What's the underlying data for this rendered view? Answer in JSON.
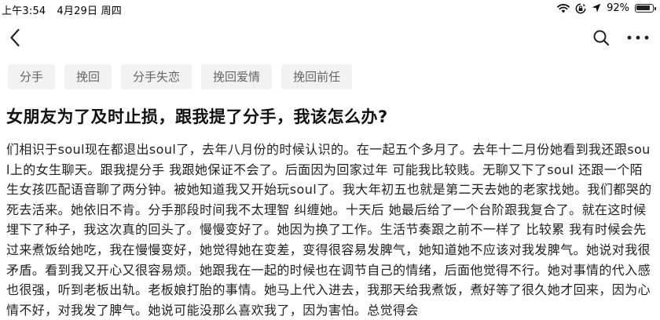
{
  "status_bar": {
    "time": "上午3:54",
    "date": "4月29日 周四",
    "battery": "92%",
    "battery_level": 0.92,
    "icons": [
      "wifi-icon",
      "screen-lock-icon",
      "location-icon",
      "battery-icon"
    ]
  },
  "nav": {
    "icons": [
      "back-chevron-icon",
      "search-icon",
      "more-icon"
    ]
  },
  "tags": [
    "分手",
    "挽回",
    "分手失恋",
    "挽回爱情",
    "挽回前任"
  ],
  "article": {
    "title": "女朋友为了及时止损，跟我提了分手，我该怎么办?",
    "body": "们相识于soul现在都退出soul了，去年八月份的时候认识的。在一起五个多月了。去年十二月份她看到我还跟soul上的女生聊天。跟我提分手 我跟她保证不会了。后面因为回家过年 可能我比较贱。无聊又下了soul 还跟一个陌生女孩匹配语音聊了两分钟。被她知道我又开始玩soul了。我大年初五也就是第二天去她的老家找她。我们都哭的死去活来。她依旧不肯。分手那段时间我不太理智 纠缠她。十天后 她最后给了一个台阶跟我复合了。就在这时候埋下了种子，我这次真的回头了。慢慢变好了。她因为换了工作。生活节奏跟之前不一样了 比较累 我有时候会先过来煮饭给她吃，我在慢慢变好，她觉得她在变差，变得很容易发脾气，她知道她不应该对我发脾气。她说对我很矛盾。看到我又开心又很容易烦。她跟我在一起的时候也在调节自己的情绪，后面他觉得不行。她对事情的代入感也很强，听到老板出轨。老板娘打胎的事情。她马上代入进去，我那天给我煮饭，煮好等了很久她才回来，因为心情不好，对我发了脾气。她说可能没那么喜欢我了，因为害怕。总觉得会"
  }
}
